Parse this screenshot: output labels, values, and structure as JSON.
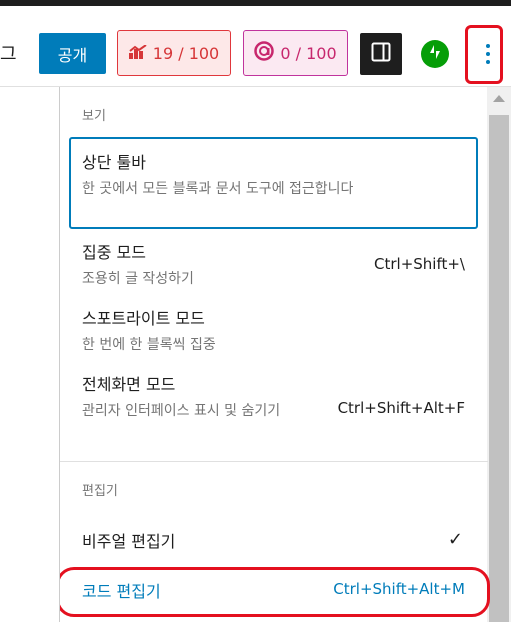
{
  "toolbar": {
    "partial_text": "그",
    "publish_label": "공개",
    "seo_score": "19 / 100",
    "readability_score": "0 / 100",
    "icons": {
      "seo": "seo-score-icon",
      "readability": "readability-score-icon",
      "sidebar": "sidebar-toggle-icon",
      "jetpack": "jetpack-icon",
      "more": "more-options-icon"
    }
  },
  "menu": {
    "view_group_label": "보기",
    "items": [
      {
        "title": "상단 툴바",
        "desc": "한 곳에서 모든 블록과 문서 도구에 접근합니다",
        "shortcut": ""
      },
      {
        "title": "집중 모드",
        "desc": "조용히 글 작성하기",
        "shortcut": "Ctrl+Shift+\\"
      },
      {
        "title": "스포트라이트 모드",
        "desc": "한 번에 한 블록씩 집중",
        "shortcut": ""
      },
      {
        "title": "전체화면 모드",
        "desc": "관리자 인터페이스 표시 및 숨기기",
        "shortcut": "Ctrl+Shift+Alt+F"
      }
    ],
    "editor_group_label": "편집기",
    "visual_editor": {
      "label": "비주얼 편집기",
      "checked": "✓"
    },
    "code_editor": {
      "label": "코드 편집기",
      "shortcut": "Ctrl+Shift+Alt+M"
    }
  },
  "colors": {
    "accent": "#007cba",
    "highlight": "#e4101f",
    "seo_red": "#d63638",
    "readability_pink": "#c7276d"
  }
}
